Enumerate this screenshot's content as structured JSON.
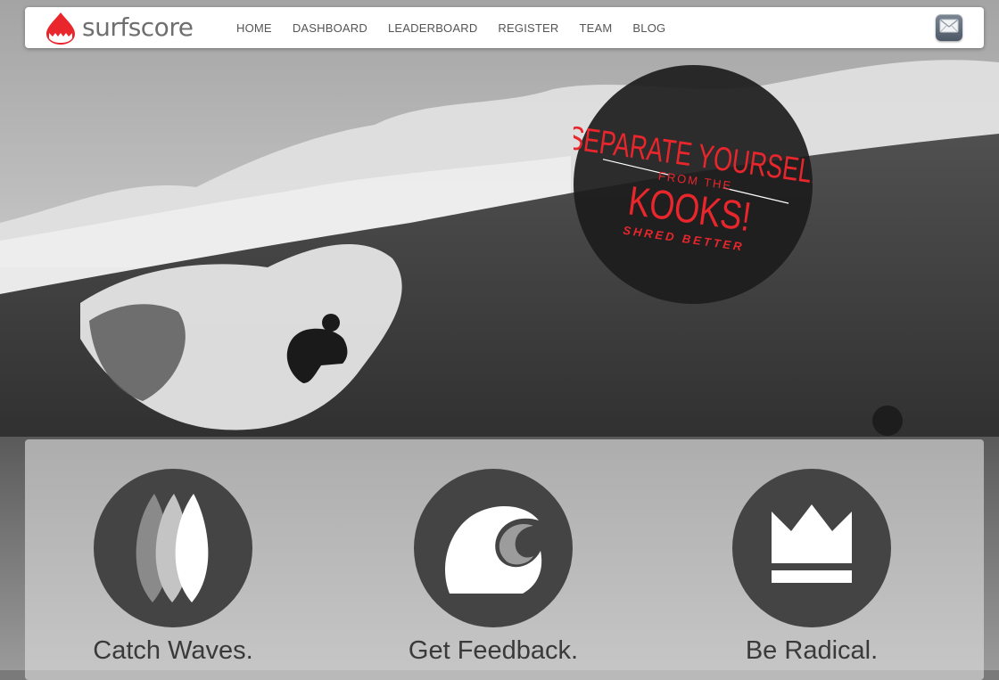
{
  "brand": {
    "name": "surfscore",
    "logo_icon": "shark-fin-logo-icon",
    "accent": "#e8262c"
  },
  "nav": {
    "items": [
      {
        "label": "HOME"
      },
      {
        "label": "DASHBOARD"
      },
      {
        "label": "LEADERBOARD"
      },
      {
        "label": "REGISTER"
      },
      {
        "label": "TEAM"
      },
      {
        "label": "BLOG"
      }
    ],
    "mail_icon": "mail-icon"
  },
  "hero": {
    "badge": {
      "line1": "SEPARATE YOURSELF",
      "line2": "FROM THE",
      "line3": "KOOKS!",
      "line4": "SHRED BETTER",
      "text_color": "#e8262c"
    }
  },
  "features": [
    {
      "label": "Catch Waves.",
      "icon": "surfboards-icon"
    },
    {
      "label": "Get Feedback.",
      "icon": "wave-icon"
    },
    {
      "label": "Be Radical.",
      "icon": "crown-icon"
    }
  ]
}
